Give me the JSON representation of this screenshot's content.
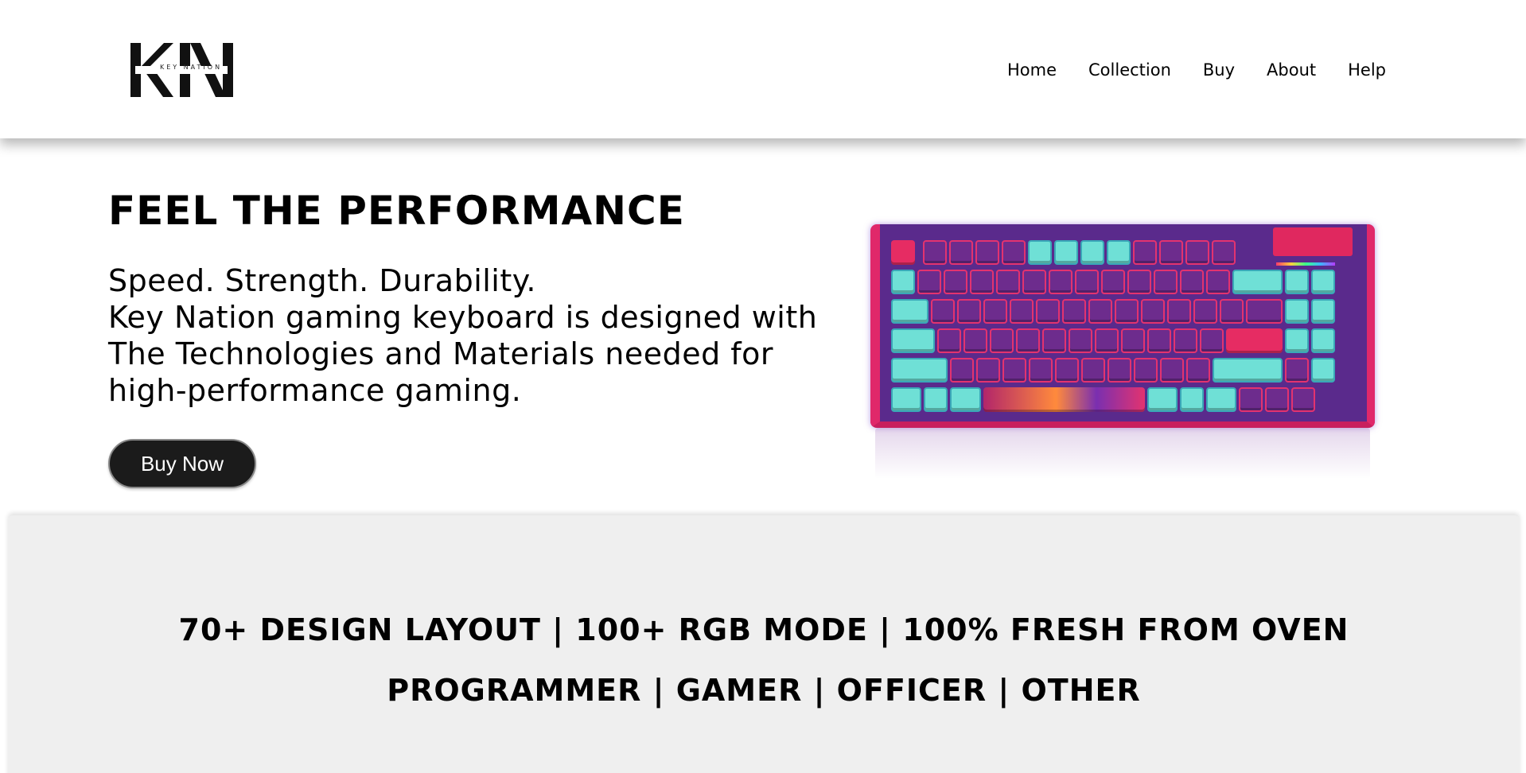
{
  "header": {
    "logo_text": "KN",
    "logo_subtitle": "KEY NATION",
    "nav": [
      {
        "label": "Home"
      },
      {
        "label": "Collection"
      },
      {
        "label": "Buy"
      },
      {
        "label": "About"
      },
      {
        "label": "Help"
      }
    ]
  },
  "hero": {
    "title": "FEEL THE PERFORMANCE",
    "description_lines": [
      "Speed. Strength. Durability.",
      "Key Nation gaming keyboard is designed with",
      "The Technologies and Materials needed for",
      "high-performance gaming."
    ],
    "cta_label": "Buy Now",
    "image_alt": "Pink and cyan mechanical gaming keyboard"
  },
  "features": {
    "line1": "70+ DESIGN LAYOUT | 100+ RGB MODE | 100% FRESH FROM OVEN",
    "line2": "PROGRAMMER | GAMER | OFFICER | OTHER"
  },
  "colors": {
    "button_bg": "#1b1b1b",
    "features_bg": "#efefef",
    "keyboard_frame": "#e0286a",
    "keyboard_body": "#5a2a8c",
    "keycap_accent": "#6fe0d6"
  }
}
